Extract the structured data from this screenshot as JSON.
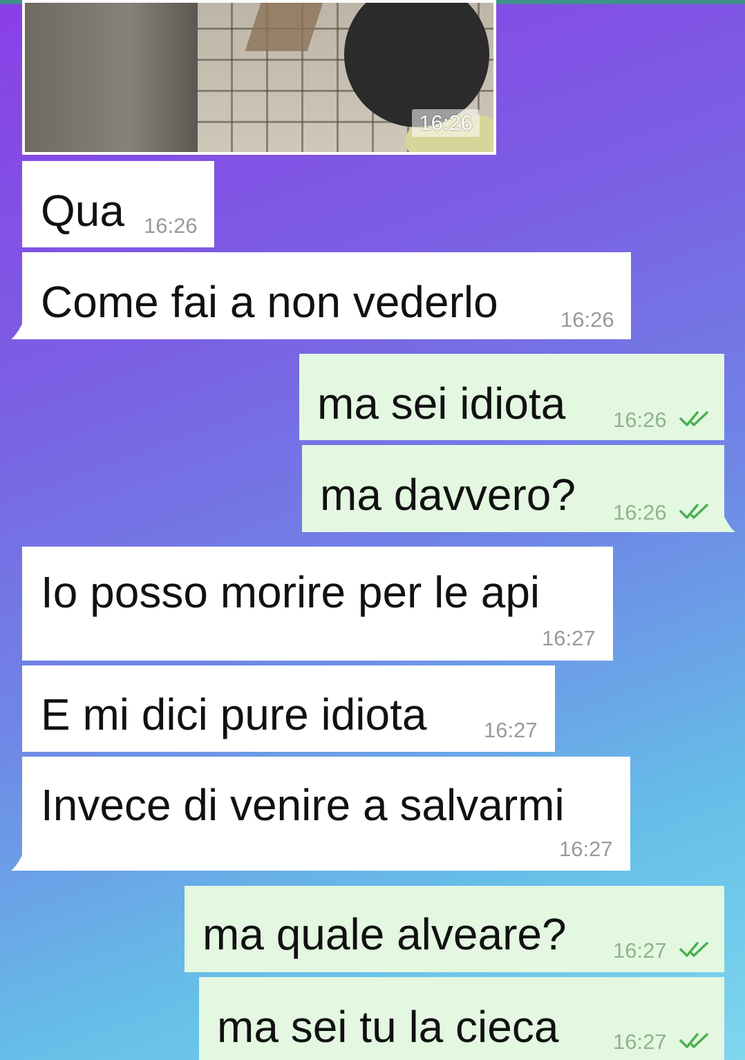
{
  "photo": {
    "time": "16:26"
  },
  "messages": [
    {
      "id": "qua",
      "direction": "in",
      "text": "Qua",
      "time": "16:26"
    },
    {
      "id": "come",
      "direction": "in",
      "text": "Come fai a non vederlo",
      "time": "16:26"
    },
    {
      "id": "idiota",
      "direction": "out",
      "text": "ma sei idiota",
      "time": "16:26",
      "status": "read"
    },
    {
      "id": "davvero",
      "direction": "out",
      "text": "ma davvero?",
      "time": "16:26",
      "status": "read"
    },
    {
      "id": "morire",
      "direction": "in",
      "text": "Io posso morire per le api",
      "time": "16:27"
    },
    {
      "id": "dici",
      "direction": "in",
      "text": "E mi dici pure idiota",
      "time": "16:27"
    },
    {
      "id": "invece",
      "direction": "in",
      "text": "Invece di venire a salvarmi",
      "time": "16:27"
    },
    {
      "id": "alveare",
      "direction": "out",
      "text": "ma quale alveare?",
      "time": "16:27",
      "status": "read"
    },
    {
      "id": "cieca",
      "direction": "out",
      "text": "ma sei tu la cieca",
      "time": "16:27",
      "status": "read"
    }
  ],
  "colors": {
    "incoming_bubble": "#ffffff",
    "outgoing_bubble": "#e3f7e1",
    "read_ticks": "#4caf50"
  }
}
